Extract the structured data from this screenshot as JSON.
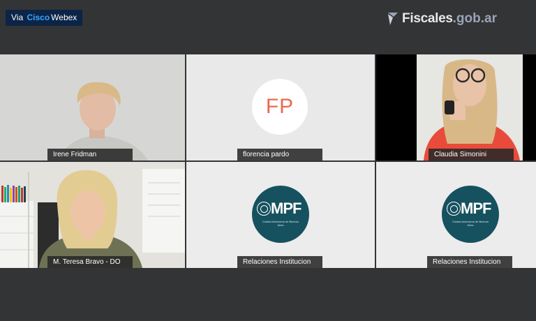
{
  "header": {
    "badge_prefix": "Via",
    "badge_brand_cisco": "Cisco",
    "badge_brand_webex": "Webex",
    "logo_name": "Fiscales",
    "logo_tld": ".gob.ar"
  },
  "participants": [
    {
      "name": "Irene Fridman"
    },
    {
      "name": "florencia pardo",
      "initials": "FP"
    },
    {
      "name": "Claudia Simonini"
    },
    {
      "name": "M. Teresa Bravo - DO"
    },
    {
      "name": "Relaciones Institucion",
      "logo_letters": "MPF",
      "logo_subtitle": "Ciudad Autónoma de Buenos Aires"
    },
    {
      "name": "Relaciones Institucion",
      "logo_letters": "MPF",
      "logo_subtitle": "Ciudad Autónoma de Buenos Aires"
    }
  ],
  "colors": {
    "background": "#333435",
    "badge": "#0b2447",
    "cisco_accent": "#3aa7ff",
    "initials_text": "#e86a4e",
    "mpf_circle": "#16515f"
  }
}
